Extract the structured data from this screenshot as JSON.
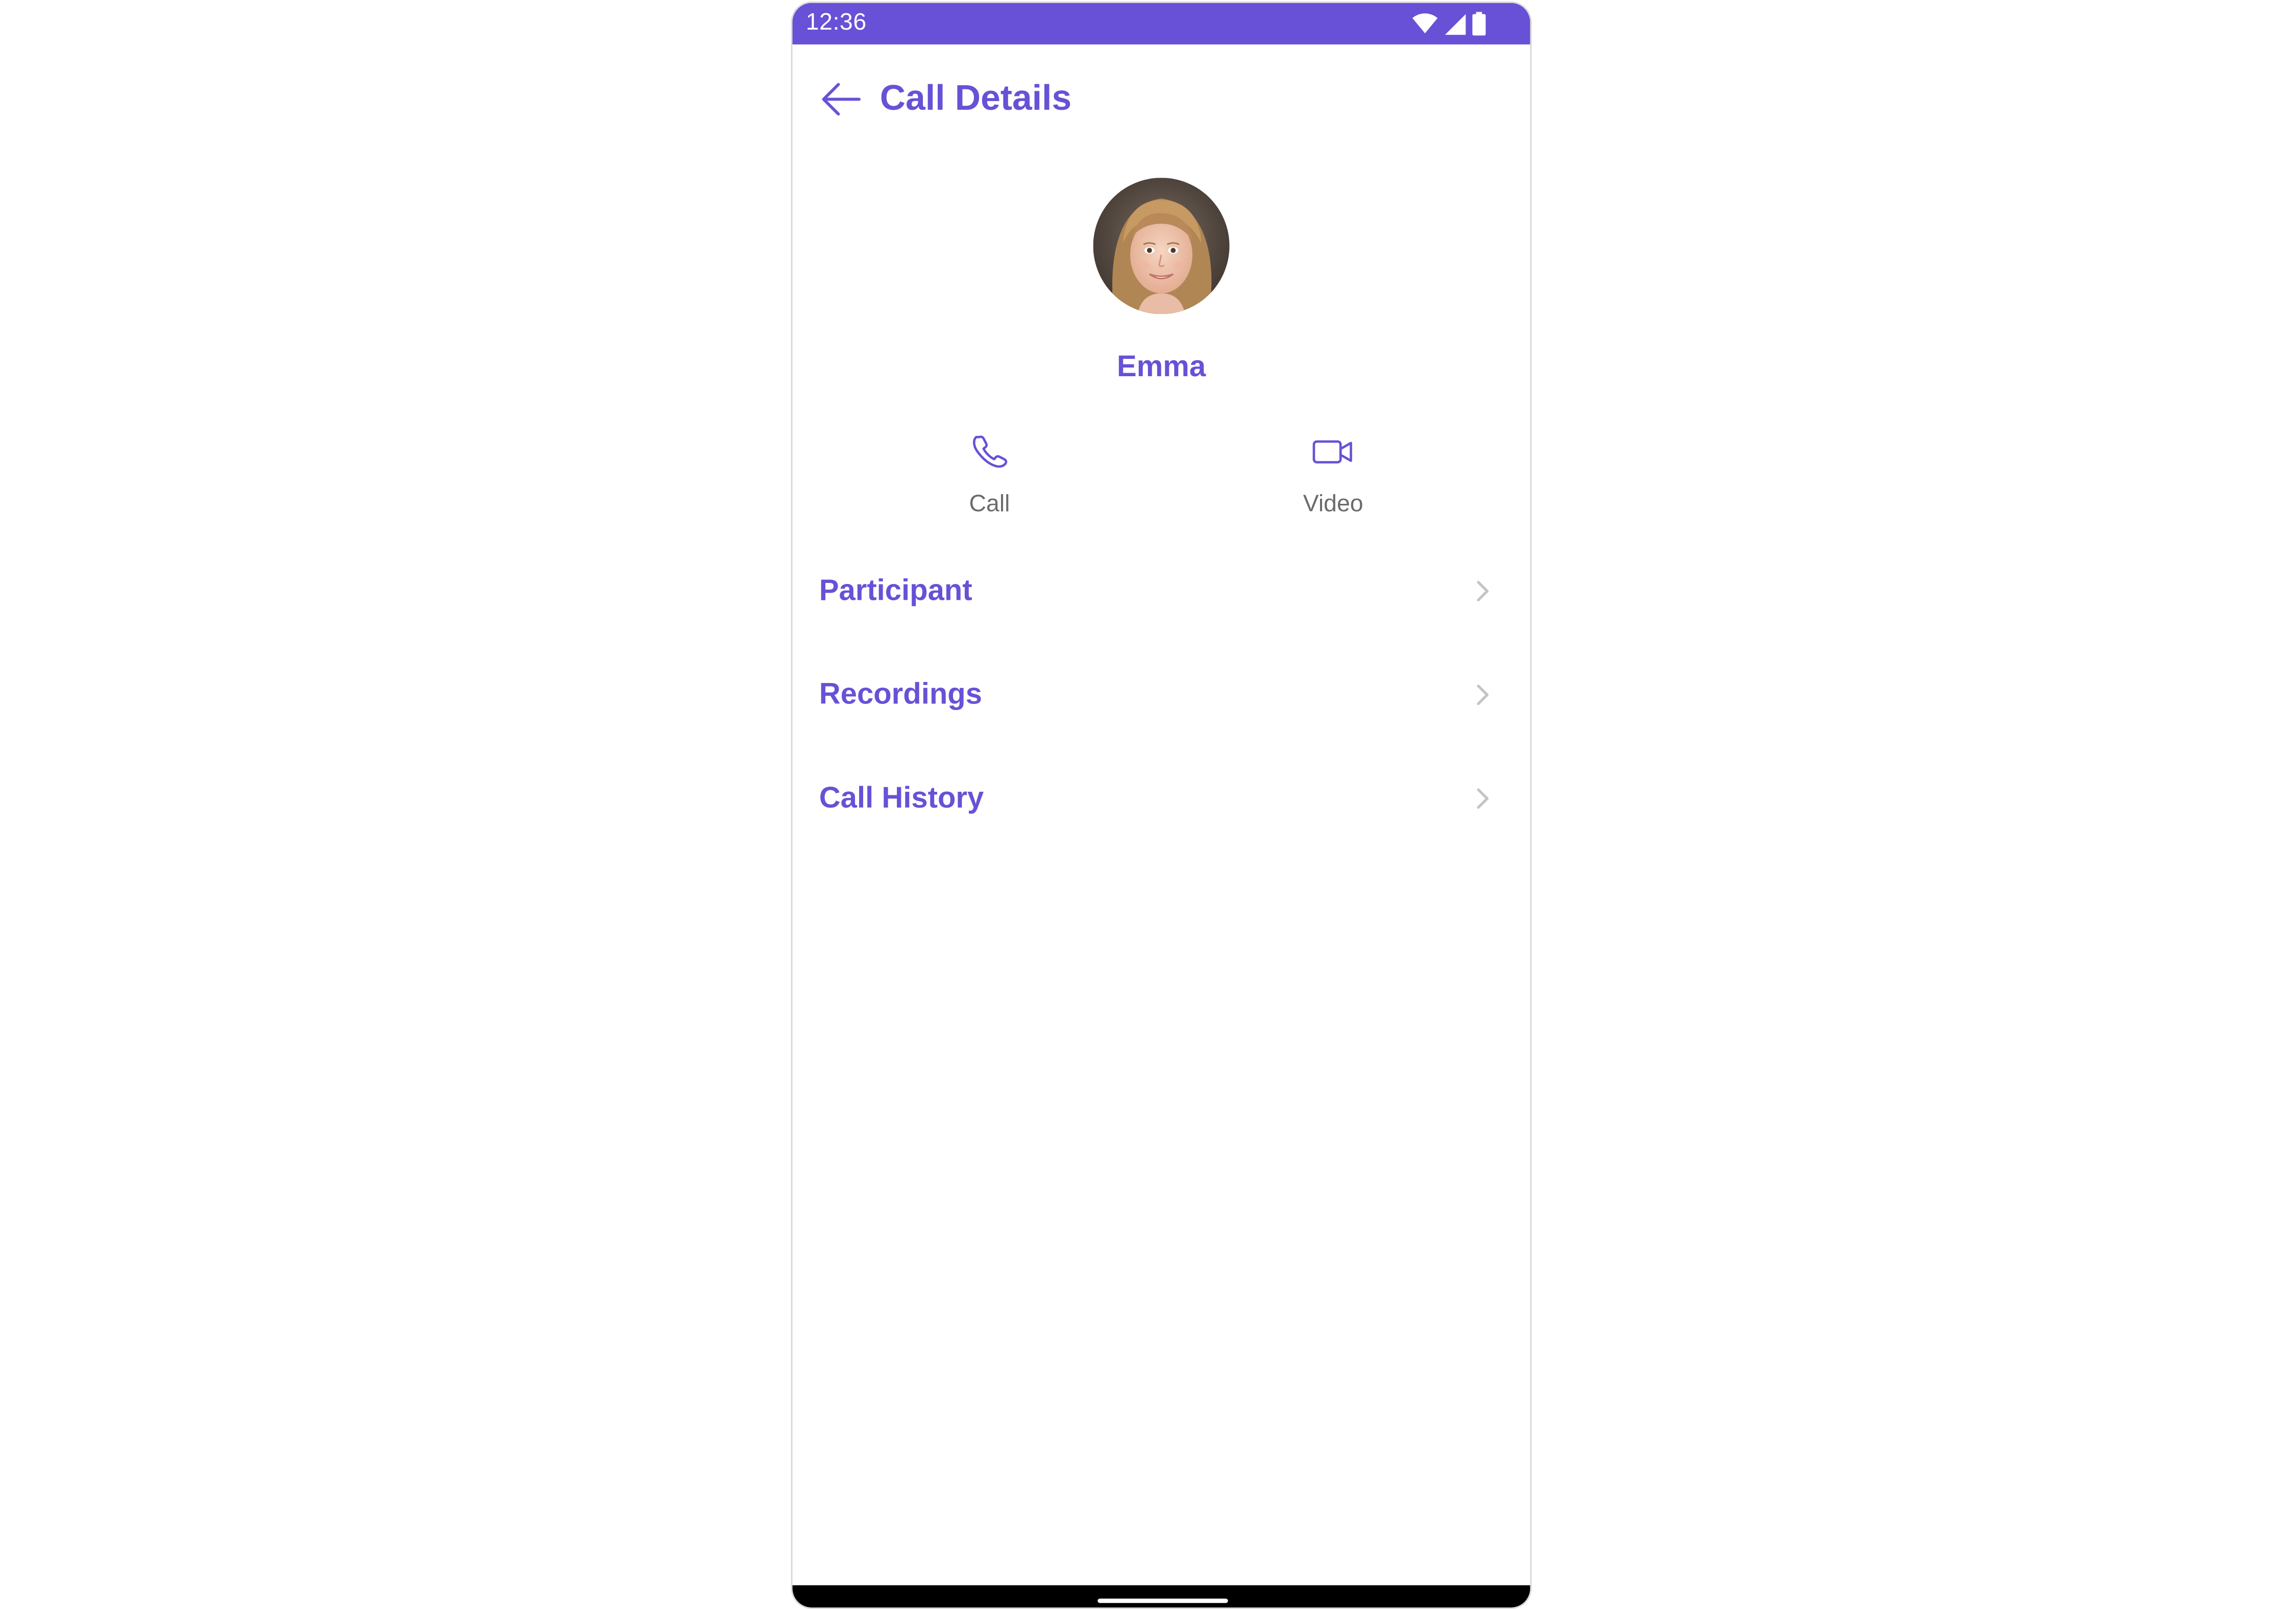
{
  "status_bar": {
    "time": "12:36",
    "icons": [
      "wifi-icon",
      "signal-icon",
      "battery-icon"
    ],
    "background": "#6851d6"
  },
  "app_bar": {
    "title": "Call Details",
    "back_icon": "arrow-left-icon"
  },
  "profile": {
    "name": "Emma",
    "avatar": "avatar-photo"
  },
  "actions": [
    {
      "label": "Call",
      "icon": "phone-icon"
    },
    {
      "label": "Video",
      "icon": "video-camera-icon"
    }
  ],
  "menu": [
    {
      "label": "Participant",
      "icon": "chevron-right-icon"
    },
    {
      "label": "Recordings",
      "icon": "chevron-right-icon"
    },
    {
      "label": "Call History",
      "icon": "chevron-right-icon"
    }
  ],
  "colors": {
    "accent": "#6851d6",
    "secondary_text": "#6b6b6b",
    "chevron": "#c4c4c4"
  }
}
